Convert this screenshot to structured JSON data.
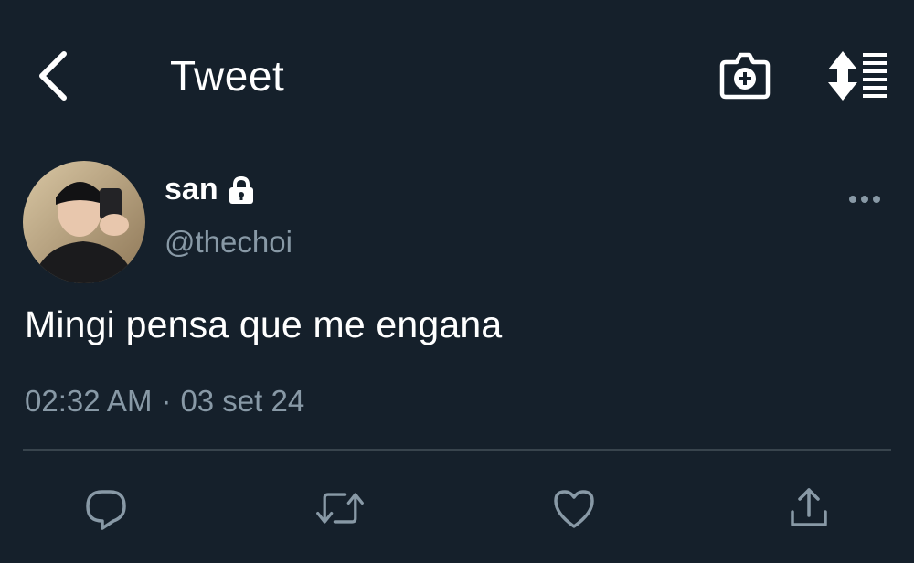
{
  "header": {
    "title": "Tweet",
    "icons": {
      "back": "chevron-left-icon",
      "camera": "camera-plus-icon",
      "sort": "sort-lines-icon"
    }
  },
  "tweet": {
    "author": {
      "display_name": "san",
      "handle": "@thechoi",
      "protected": true
    },
    "text": "Mingi pensa que me engana",
    "time": "02:32 AM",
    "separator": "·",
    "date": "03 set 24"
  },
  "actions": {
    "icons": [
      "reply-icon",
      "retweet-icon",
      "like-icon",
      "share-icon"
    ]
  },
  "colors": {
    "background": "#15202b",
    "primary_text": "#ffffff",
    "secondary_text": "#8899a6",
    "divider": "#38444d"
  }
}
